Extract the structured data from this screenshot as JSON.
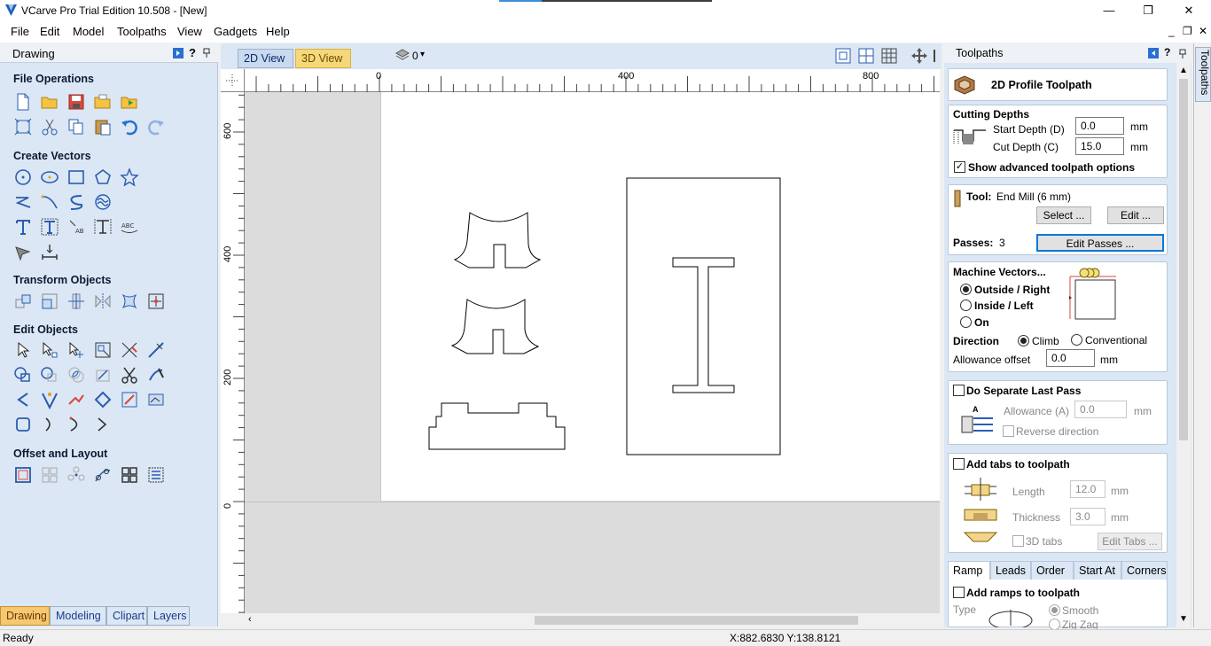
{
  "window": {
    "title": "VCarve Pro Trial Edition 10.508 - [New]",
    "minimize": "—",
    "maximize": "❐",
    "close": "✕"
  },
  "menu": {
    "items": [
      "File",
      "Edit",
      "Model",
      "Toolpaths",
      "View",
      "Gadgets",
      "Help"
    ],
    "child_min": "_",
    "child_restore": "❐",
    "child_close": "✕"
  },
  "left_panel": {
    "title": "Drawing",
    "sections": [
      "File Operations",
      "Create Vectors",
      "Transform Objects",
      "Edit Objects",
      "Offset and Layout"
    ],
    "bottom_tabs": [
      "Drawing",
      "Modeling",
      "Clipart",
      "Layers"
    ]
  },
  "view": {
    "tabs": [
      "2D View",
      "3D View"
    ],
    "layer_count": "0",
    "ruler_top": [
      "0",
      "400",
      "800"
    ],
    "ruler_left": [
      "600",
      "400",
      "200",
      "0"
    ]
  },
  "toolpaths_panel": {
    "header": "Toolpaths",
    "title": "2D Profile Toolpath",
    "cutting_depths": {
      "label": "Cutting Depths",
      "start_label": "Start Depth (D)",
      "start_value": "0.0",
      "cut_label": "Cut Depth (C)",
      "cut_value": "15.0",
      "unit": "mm",
      "advanced_label": "Show advanced toolpath options",
      "advanced_checked": true
    },
    "tool": {
      "label": "Tool:",
      "name": "End Mill (6 mm)",
      "select_btn": "Select ...",
      "edit_btn": "Edit ...",
      "passes_label": "Passes:",
      "passes_value": "3",
      "edit_passes_btn": "Edit Passes ..."
    },
    "machine_vectors": {
      "label": "Machine Vectors...",
      "options": [
        "Outside / Right",
        "Inside / Left",
        "On"
      ],
      "selected": 0,
      "direction_label": "Direction",
      "climb": "Climb",
      "conventional": "Conventional",
      "allowance_label": "Allowance offset",
      "allowance_value": "0.0",
      "unit": "mm"
    },
    "separate_pass": {
      "label": "Do Separate Last Pass",
      "allowance_label": "Allowance (A)",
      "allowance_value": "0.0",
      "unit": "mm",
      "reverse_label": "Reverse direction",
      "letter": "A"
    },
    "tabs": {
      "label": "Add tabs to toolpath",
      "length_label": "Length",
      "length_value": "12.0",
      "thickness_label": "Thickness",
      "thickness_value": "3.0",
      "unit": "mm",
      "tabs3d_label": "3D tabs",
      "edit_tabs_btn": "Edit Tabs ..."
    },
    "lower_tabs": [
      "Ramp",
      "Leads",
      "Order",
      "Start At",
      "Corners"
    ],
    "ramps": {
      "label": "Add ramps to toolpath",
      "type_label": "Type",
      "smooth": "Smooth",
      "zigzag": "Zig Zag"
    },
    "side_tab": "Toolpaths"
  },
  "status": {
    "left": "Ready",
    "coords": "X:882.6830 Y:138.8121"
  },
  "colors": {
    "panel_bg": "#dbe7f4",
    "active_tab": "#f6c872",
    "view_tab_2d": "#c9d9ee",
    "view_tab_3d": "#f6d77a"
  }
}
